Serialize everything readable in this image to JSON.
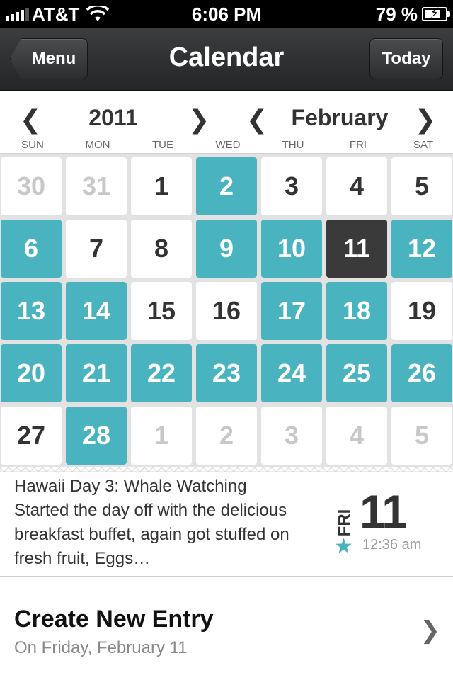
{
  "status": {
    "carrier": "AT&T",
    "time": "6:06 PM",
    "battery_percent": "79 %",
    "battery_level": 0.79
  },
  "nav": {
    "title": "Calendar",
    "menu_label": "Menu",
    "today_label": "Today"
  },
  "selector": {
    "year": "2011",
    "month": "February",
    "days_of_week": [
      "SUN",
      "MON",
      "TUE",
      "WED",
      "THU",
      "FRI",
      "SAT"
    ]
  },
  "calendar": {
    "weeks": [
      [
        {
          "d": "30",
          "s": "other"
        },
        {
          "d": "31",
          "s": "other"
        },
        {
          "d": "1",
          "s": ""
        },
        {
          "d": "2",
          "s": "entry"
        },
        {
          "d": "3",
          "s": ""
        },
        {
          "d": "4",
          "s": ""
        },
        {
          "d": "5",
          "s": ""
        }
      ],
      [
        {
          "d": "6",
          "s": "entry"
        },
        {
          "d": "7",
          "s": ""
        },
        {
          "d": "8",
          "s": ""
        },
        {
          "d": "9",
          "s": "entry"
        },
        {
          "d": "10",
          "s": "entry"
        },
        {
          "d": "11",
          "s": "sel"
        },
        {
          "d": "12",
          "s": "entry"
        }
      ],
      [
        {
          "d": "13",
          "s": "entry"
        },
        {
          "d": "14",
          "s": "entry"
        },
        {
          "d": "15",
          "s": ""
        },
        {
          "d": "16",
          "s": ""
        },
        {
          "d": "17",
          "s": "entry"
        },
        {
          "d": "18",
          "s": "entry"
        },
        {
          "d": "19",
          "s": ""
        }
      ],
      [
        {
          "d": "20",
          "s": "entry"
        },
        {
          "d": "21",
          "s": "entry"
        },
        {
          "d": "22",
          "s": "entry"
        },
        {
          "d": "23",
          "s": "entry"
        },
        {
          "d": "24",
          "s": "entry"
        },
        {
          "d": "25",
          "s": "entry"
        },
        {
          "d": "26",
          "s": "entry"
        }
      ],
      [
        {
          "d": "27",
          "s": ""
        },
        {
          "d": "28",
          "s": "entry"
        },
        {
          "d": "1",
          "s": "other"
        },
        {
          "d": "2",
          "s": "other"
        },
        {
          "d": "3",
          "s": "other"
        },
        {
          "d": "4",
          "s": "other"
        },
        {
          "d": "5",
          "s": "other"
        }
      ]
    ]
  },
  "entry": {
    "title": "Hawaii Day 3: Whale Watching",
    "body": "Started the day off with the delicious breakfast buffet, again got stuffed on fresh fruit, Eggs…",
    "day_abbr": "FRI",
    "day_num": "11",
    "time": "12:36 am"
  },
  "create": {
    "title": "Create New Entry",
    "subtitle": "On Friday, February 11"
  },
  "colors": {
    "entry": "#4ab3c0",
    "selected": "#3a3a3a",
    "accent": "#4ab3c0"
  }
}
